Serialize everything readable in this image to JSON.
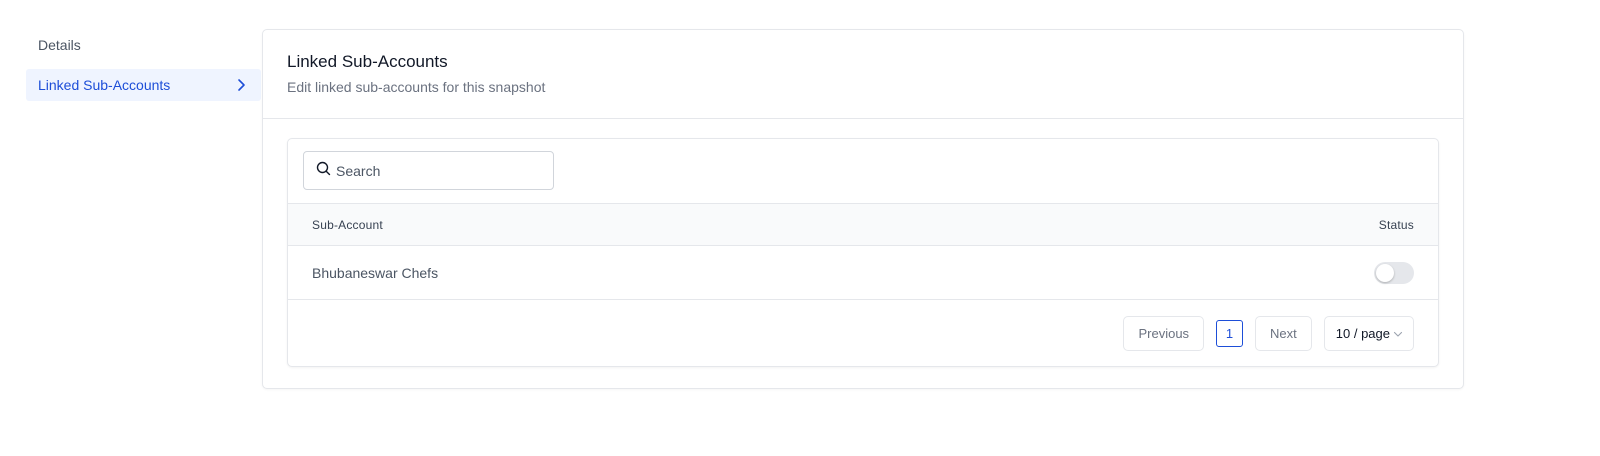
{
  "sidebar": {
    "items": [
      {
        "label": "Details",
        "active": false
      },
      {
        "label": "Linked Sub-Accounts",
        "active": true
      }
    ]
  },
  "card": {
    "title": "Linked Sub-Accounts",
    "subtitle": "Edit linked sub-accounts for this snapshot"
  },
  "search": {
    "placeholder": "Search",
    "value": ""
  },
  "table": {
    "columns": [
      "Sub-Account",
      "Status"
    ],
    "rows": [
      {
        "name": "Bhubaneswar Chefs",
        "status_enabled": false
      }
    ]
  },
  "pagination": {
    "previous_label": "Previous",
    "current_page": "1",
    "next_label": "Next",
    "page_size_label": "10 / page"
  },
  "colors": {
    "accent": "#1d4ed8",
    "active_bg": "#eff4ff"
  },
  "icons": {
    "sidebar_active": "chevron-right-icon",
    "search": "search-icon",
    "page_size": "chevron-down-icon"
  }
}
